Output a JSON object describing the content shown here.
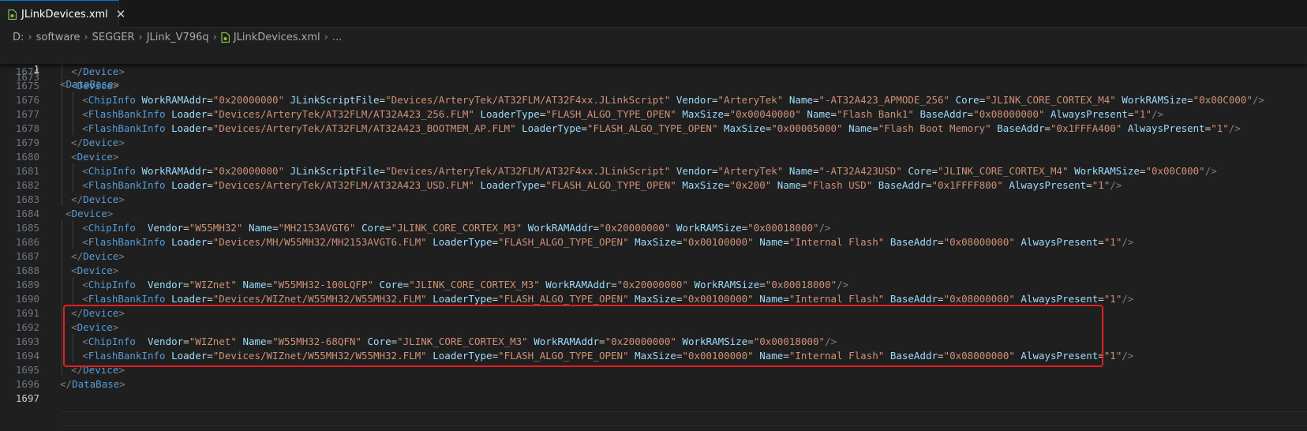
{
  "tab": {
    "label": "JLinkDevices.xml",
    "close_glyph": "✕"
  },
  "breadcrumb": [
    {
      "label": "D:"
    },
    {
      "label": "software"
    },
    {
      "label": "SEGGER"
    },
    {
      "label": "JLink_V796q"
    },
    {
      "label": "JLinkDevices.xml",
      "icon": "xml-file-icon"
    },
    {
      "label": "..."
    }
  ],
  "sticky": {
    "number": "1",
    "peek_number": "1673",
    "text": "<DataBase>"
  },
  "lines": [
    {
      "n": "1674",
      "indent": 2,
      "text": "</Device>"
    },
    {
      "n": "1675",
      "indent": 2,
      "text": "<Device>"
    },
    {
      "n": "1676",
      "indent": 4,
      "text": "<ChipInfo WorkRAMAddr=\"0x20000000\" JLinkScriptFile=\"Devices/ArteryTek/AT32FLM/AT32F4xx.JLinkScript\" Vendor=\"ArteryTek\" Name=\"-AT32A423_APMODE_256\" Core=\"JLINK_CORE_CORTEX_M4\" WorkRAMSize=\"0x00C000\"/>"
    },
    {
      "n": "1677",
      "indent": 4,
      "text": "<FlashBankInfo Loader=\"Devices/ArteryTek/AT32FLM/AT32A423_256.FLM\" LoaderType=\"FLASH_ALGO_TYPE_OPEN\" MaxSize=\"0x00040000\" Name=\"Flash Bank1\" BaseAddr=\"0x08000000\" AlwaysPresent=\"1\"/>"
    },
    {
      "n": "1678",
      "indent": 4,
      "text": "<FlashBankInfo Loader=\"Devices/ArteryTek/AT32FLM/AT32A423_BOOTMEM_AP.FLM\" LoaderType=\"FLASH_ALGO_TYPE_OPEN\" MaxSize=\"0x00005000\" Name=\"Flash Boot Memory\" BaseAddr=\"0x1FFFA400\" AlwaysPresent=\"1\"/>"
    },
    {
      "n": "1679",
      "indent": 2,
      "text": "</Device>"
    },
    {
      "n": "1680",
      "indent": 2,
      "text": "<Device>"
    },
    {
      "n": "1681",
      "indent": 4,
      "text": "<ChipInfo WorkRAMAddr=\"0x20000000\" JLinkScriptFile=\"Devices/ArteryTek/AT32FLM/AT32F4xx.JLinkScript\" Vendor=\"ArteryTek\" Name=\"-AT32A423USD\" Core=\"JLINK_CORE_CORTEX_M4\" WorkRAMSize=\"0x00C000\"/>"
    },
    {
      "n": "1682",
      "indent": 4,
      "text": "<FlashBankInfo Loader=\"Devices/ArteryTek/AT32FLM/AT32A423_USD.FLM\" LoaderType=\"FLASH_ALGO_TYPE_OPEN\" MaxSize=\"0x200\" Name=\"Flash USD\" BaseAddr=\"0x1FFFF800\" AlwaysPresent=\"1\"/>"
    },
    {
      "n": "1683",
      "indent": 2,
      "text": "</Device>"
    },
    {
      "n": "1684",
      "indent": 1,
      "text": "<Device>"
    },
    {
      "n": "1685",
      "indent": 4,
      "text": "<ChipInfo  Vendor=\"W55MH32\" Name=\"MH2153AVGT6\" Core=\"JLINK_CORE_CORTEX_M3\" WorkRAMAddr=\"0x20000000\" WorkRAMSize=\"0x00018000\"/>"
    },
    {
      "n": "1686",
      "indent": 4,
      "text": "<FlashBankInfo Loader=\"Devices/MH/W55MH32/MH2153AVGT6.FLM\" LoaderType=\"FLASH_ALGO_TYPE_OPEN\" MaxSize=\"0x00100000\" Name=\"Internal Flash\" BaseAddr=\"0x08000000\" AlwaysPresent=\"1\"/>"
    },
    {
      "n": "1687",
      "indent": 2,
      "text": "</Device>"
    },
    {
      "n": "1688",
      "indent": 2,
      "text": "<Device>"
    },
    {
      "n": "1689",
      "indent": 4,
      "text": "<ChipInfo  Vendor=\"WIZnet\" Name=\"W55MH32-100LQFP\" Core=\"JLINK_CORE_CORTEX_M3\" WorkRAMAddr=\"0x20000000\" WorkRAMSize=\"0x00018000\"/>"
    },
    {
      "n": "1690",
      "indent": 4,
      "text": "<FlashBankInfo Loader=\"Devices/WIZnet/W55MH32/W55MH32.FLM\" LoaderType=\"FLASH_ALGO_TYPE_OPEN\" MaxSize=\"0x00100000\" Name=\"Internal Flash\" BaseAddr=\"0x08000000\" AlwaysPresent=\"1\"/>"
    },
    {
      "n": "1691",
      "indent": 2,
      "text": "</Device>"
    },
    {
      "n": "1692",
      "indent": 2,
      "text": "<Device>"
    },
    {
      "n": "1693",
      "indent": 4,
      "text": "<ChipInfo  Vendor=\"WIZnet\" Name=\"W55MH32-68QFN\" Core=\"JLINK_CORE_CORTEX_M3\" WorkRAMAddr=\"0x20000000\" WorkRAMSize=\"0x00018000\"/>"
    },
    {
      "n": "1694",
      "indent": 4,
      "text": "<FlashBankInfo Loader=\"Devices/WIZnet/W55MH32/W55MH32.FLM\" LoaderType=\"FLASH_ALGO_TYPE_OPEN\" MaxSize=\"0x00100000\" Name=\"Internal Flash\" BaseAddr=\"0x08000000\" AlwaysPresent=\"1\"/>"
    },
    {
      "n": "1695",
      "indent": 2,
      "text": "</Device>"
    },
    {
      "n": "1696",
      "indent": 0,
      "text": "</DataBase>"
    },
    {
      "n": "1697",
      "indent": 0,
      "text": ""
    }
  ],
  "colors": {
    "bracket": "#808080",
    "tag": "#569cd6",
    "attribute": "#9cdcfe",
    "value": "#ce9178",
    "highlight_box": "#e02020",
    "tab_accent": "#0078d4"
  }
}
